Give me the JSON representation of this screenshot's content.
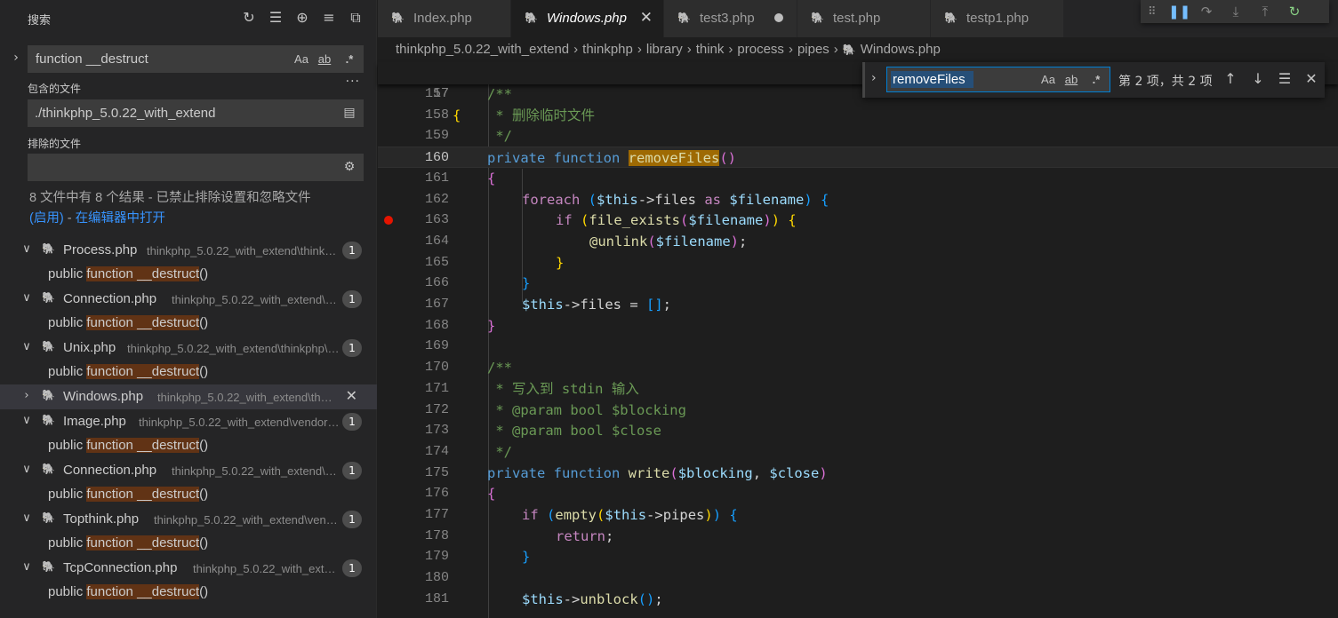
{
  "sidebar": {
    "title": "搜索",
    "search": {
      "value": "function __destruct",
      "opt_case": "Aa",
      "opt_word": "ab",
      "opt_regex": ".*"
    },
    "include_label": "包含的文件",
    "include_value": "./thinkphp_5.0.22_with_extend",
    "exclude_label": "排除的文件",
    "exclude_value": "",
    "summary_text": "8 文件中有 8 个结果 - 已禁止排除设置和忽略文件",
    "summary_enabled": "(启用)",
    "summary_dash": " - ",
    "summary_open": "在编辑器中打开",
    "results": [
      {
        "file": "Process.php",
        "path": "thinkphp_5.0.22_with_extend\\think\\process",
        "count": "1",
        "match_pre": "public ",
        "match_hl": "function __destruct",
        "match_post": "()"
      },
      {
        "file": "Connection.php",
        "path": "thinkphp_5.0.22_with_extend\\think\\db",
        "count": "1",
        "match_pre": "public ",
        "match_hl": "function __destruct",
        "match_post": "()"
      },
      {
        "file": "Unix.php",
        "path": "thinkphp_5.0.22_with_extend\\thinkphp\\library",
        "count": "1",
        "match_pre": "public ",
        "match_hl": "function __destruct",
        "match_post": "()"
      },
      {
        "file": "Windows.php",
        "path": "thinkphp_5.0.22_with_extend\\thinkphp",
        "count": "",
        "selected": true
      },
      {
        "file": "Image.php",
        "path": "thinkphp_5.0.22_with_extend\\vendor\\image",
        "count": "1",
        "match_pre": "public ",
        "match_hl": "function __destruct",
        "match_post": "()"
      },
      {
        "file": "Connection.php",
        "path": "thinkphp_5.0.22_with_extend\\vendor\\mongo",
        "count": "1",
        "match_pre": "public ",
        "match_hl": "function __destruct",
        "match_post": "()"
      },
      {
        "file": "Topthink.php",
        "path": "thinkphp_5.0.22_with_extend\\vendor\\topthink",
        "count": "1",
        "match_pre": "public ",
        "match_hl": "function __destruct",
        "match_post": "()"
      },
      {
        "file": "TcpConnection.php",
        "path": "thinkphp_5.0.22_with_extend\\vendor",
        "count": "1",
        "match_pre": "public ",
        "match_hl": "function __destruct",
        "match_post": "()"
      }
    ]
  },
  "tabs": [
    {
      "label": "Index.php",
      "state": "normal"
    },
    {
      "label": "Windows.php",
      "state": "active"
    },
    {
      "label": "test3.php",
      "state": "dirty"
    },
    {
      "label": "test.php",
      "state": "normal"
    },
    {
      "label": "testp1.php",
      "state": "normal"
    }
  ],
  "breadcrumbs": [
    "thinkphp_5.0.22_with_extend",
    "thinkphp",
    "library",
    "think",
    "process",
    "pipes",
    "Windows.php"
  ],
  "find": {
    "value": "removeFiles",
    "count": "第 2 项，共 2 项",
    "opt_case": "Aa",
    "opt_word": "ab",
    "opt_regex": ".*"
  },
  "sticky": {
    "line": "17",
    "code": "{"
  },
  "lines": [
    "157",
    "158",
    "159",
    "160",
    "161",
    "162",
    "163",
    "164",
    "165",
    "166",
    "167",
    "168",
    "169",
    "170",
    "171",
    "172",
    "173",
    "174",
    "175",
    "176",
    "177",
    "178",
    "179",
    "180",
    "181"
  ],
  "code": {
    "c157": "/**",
    "c158": " * 删除临时文件",
    "c159": " */",
    "k160a": "private",
    "k160b": "function",
    "f160": "removeFiles",
    "b160": "()",
    "b161": "{",
    "k162": "foreach",
    "v162a": "$this",
    "t162a": "->files ",
    "k162b": "as",
    "v162b": "$filename",
    "f163": "file_exists",
    "v163": "$filename",
    "k163": "if",
    "f164": "@unlink",
    "v164": "$filename",
    "v167": "$this",
    "t167": "->files = ",
    "c170": "/**",
    "c171": " * 写入到 stdin 输入",
    "c172": " * @param bool $blocking",
    "c173": " * @param bool $close",
    "c174": " */",
    "k175a": "private",
    "k175b": "function",
    "f175": "write",
    "v175a": "$blocking",
    "v175b": "$close",
    "k177": "if",
    "f177": "empty",
    "v177": "$this",
    "t177": "->pipes",
    "k178": "return",
    "v181": "$this",
    "t181": "->",
    "f181": "unblock"
  }
}
